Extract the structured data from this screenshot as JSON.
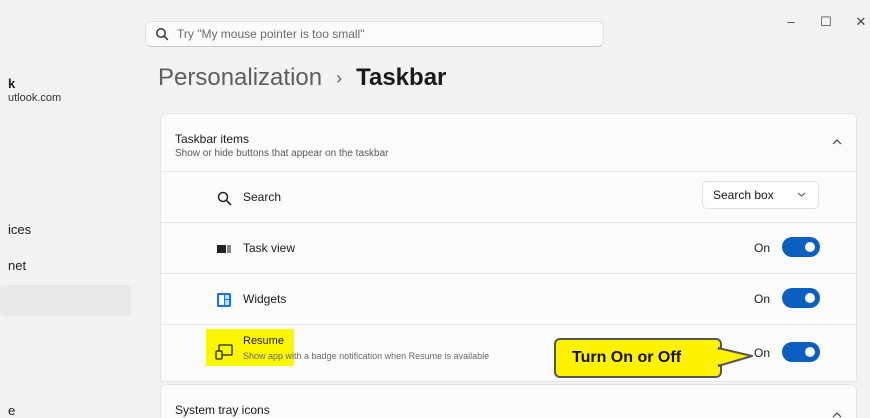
{
  "search": {
    "placeholder": "Try \"My mouse pointer is too small\""
  },
  "window": {
    "minimize": "–",
    "maximize": "☐",
    "close": "✕"
  },
  "account": {
    "name": "k",
    "email": "utlook.com"
  },
  "sidebar": {
    "items": [
      {
        "label": "ices"
      },
      {
        "label": "net"
      },
      {
        "label": "e"
      }
    ]
  },
  "breadcrumb": {
    "parent": "Personalization",
    "separator": "›",
    "current": "Taskbar"
  },
  "section": {
    "title": "Taskbar items",
    "subtitle": "Show or hide buttons that appear on the taskbar"
  },
  "rows": [
    {
      "label": "Search",
      "dropdown_value": "Search box",
      "icon": "search-icon"
    },
    {
      "label": "Task view",
      "state": "On",
      "toggle_on": true,
      "icon": "task-view-icon"
    },
    {
      "label": "Widgets",
      "state": "On",
      "toggle_on": true,
      "icon": "widgets-icon"
    },
    {
      "label": "Resume",
      "description": "Show app with a badge notification when Resume is available",
      "state": "On",
      "toggle_on": true,
      "icon": "resume-icon"
    }
  ],
  "next_section": {
    "title": "System tray icons"
  },
  "callout": {
    "text": "Turn On or Off",
    "color": "#fff200"
  },
  "colors": {
    "accent": "#0a5fc0",
    "highlight": "#fbf700"
  }
}
